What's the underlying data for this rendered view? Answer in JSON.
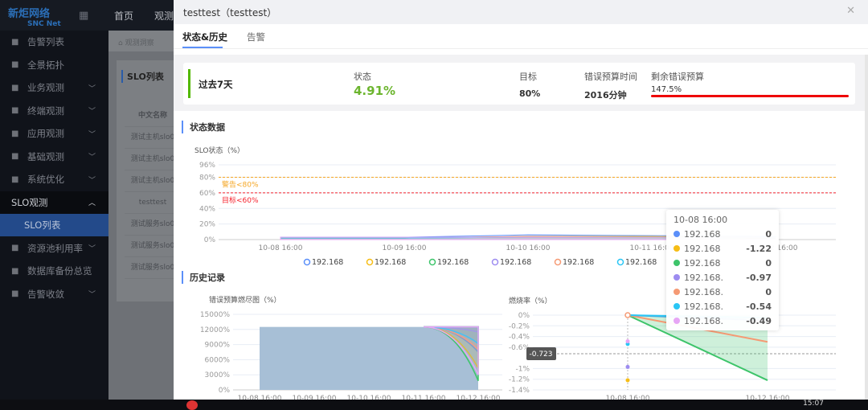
{
  "app": {
    "logo_cn": "新炬网络",
    "logo_en": "SNC Net",
    "nav": [
      "首页",
      "观测"
    ]
  },
  "sidebar": {
    "items": [
      {
        "label": "告警列表",
        "icon": "alert-list-icon",
        "chev": false
      },
      {
        "label": "全景拓扑",
        "icon": "topology-icon",
        "chev": false
      },
      {
        "label": "业务观测",
        "icon": "business-chart-icon",
        "chev": true
      },
      {
        "label": "终端观测",
        "icon": "globe-icon",
        "chev": true
      },
      {
        "label": "应用观测",
        "icon": "app-cluster-icon",
        "chev": true
      },
      {
        "label": "基础观测",
        "icon": "grid-icon",
        "chev": true
      },
      {
        "label": "系统优化",
        "icon": "system-icon",
        "chev": true
      },
      {
        "label": "SLO观测",
        "icon": "",
        "chev": true,
        "expanded": true
      },
      {
        "label": "SLO列表",
        "icon": "",
        "active": true
      },
      {
        "label": "资源池利用率",
        "icon": "resource-icon",
        "chev": true
      },
      {
        "label": "数据库备份总览",
        "icon": "database-icon",
        "chev": false
      },
      {
        "label": "告警收敛",
        "icon": "alert-converge-icon",
        "chev": true
      }
    ]
  },
  "background": {
    "breadcrumb": "观测洞察",
    "list_title": "SLO列表",
    "column": "中文名称",
    "rows": [
      "测试主机slo0",
      "测试主机slo0",
      "测试主机slo0",
      "testtest",
      "测试服务slo0",
      "测试服务slo0",
      "测试服务slo0"
    ]
  },
  "drawer": {
    "title": "testtest（testtest）",
    "tabs": [
      "状态&历史",
      "告警"
    ],
    "summary": {
      "period": "过去7天",
      "status_label": "状态",
      "status_value": "4.91%",
      "target_label": "目标",
      "target_value": "80%",
      "budget_time_label": "错误预算时间",
      "budget_time_value": "2016分钟",
      "remaining_label": "剩余错误预算",
      "remaining_value": "147.5%"
    },
    "sections": {
      "status": "状态数据",
      "history": "历史记录"
    }
  },
  "colors": {
    "series": [
      "#5b8ff9",
      "#f6bd16",
      "#3dc46a",
      "#9d8cf0",
      "#f59a74",
      "#2ac6f5",
      "#e6a6f5"
    ],
    "warn": "#f5a623",
    "target": "#f5222d",
    "accent": "#5b8ff9",
    "good": "#52b800"
  },
  "chart_data": [
    {
      "type": "area",
      "ylabel": "SLO状态（%）",
      "yticks": [
        "0%",
        "20%",
        "40%",
        "60%",
        "80%",
        "96%"
      ],
      "ylim": [
        0,
        96
      ],
      "xticks": [
        "10-08 16:00",
        "10-09 16:00",
        "10-10 16:00",
        "10-11 16:00",
        "10-12 16:00"
      ],
      "thresholds": [
        {
          "label": "警告<80%",
          "value": 80
        },
        {
          "label": "目标<60%",
          "value": 60
        }
      ],
      "legend": [
        "192.168",
        "192.168",
        "192.168",
        "192.168",
        "192.168",
        "192.168",
        "192.168"
      ],
      "series": [
        {
          "values": [
            3,
            3,
            6,
            5,
            4
          ]
        },
        {
          "values": [
            2,
            2,
            4,
            4,
            3
          ]
        },
        {
          "values": [
            2,
            2,
            3,
            3,
            2
          ]
        },
        {
          "values": [
            3,
            3,
            3,
            3,
            3
          ]
        },
        {
          "values": [
            2,
            2,
            4,
            3,
            3
          ]
        },
        {
          "values": [
            2,
            2,
            3,
            3,
            3
          ]
        },
        {
          "values": [
            3,
            3,
            3,
            3,
            3
          ]
        }
      ]
    },
    {
      "type": "area",
      "ylabel": "错误预算燃尽图（%）",
      "yticks": [
        "0%",
        "3000%",
        "6000%",
        "9000%",
        "12000%",
        "15000%"
      ],
      "ylim": [
        0,
        15000
      ],
      "xticks": [
        "10-08 16:00",
        "10-09 16:00",
        "10-10 16:00",
        "10-11 16:00",
        "10-12 16:00"
      ],
      "series": [
        {
          "values": [
            12500,
            12500,
            12500,
            12500,
            7500
          ]
        },
        {
          "values": [
            12500,
            12500,
            12500,
            12500,
            4300
          ]
        },
        {
          "values": [
            12500,
            12500,
            12500,
            12500,
            1800
          ]
        },
        {
          "values": [
            12500,
            12500,
            12500,
            12500,
            11500
          ]
        },
        {
          "values": [
            12500,
            12500,
            12500,
            12500,
            8000
          ]
        },
        {
          "values": [
            12500,
            12500,
            12500,
            12500,
            9200
          ]
        },
        {
          "values": [
            12500,
            12500,
            12500,
            12500,
            3000
          ]
        }
      ]
    },
    {
      "type": "line",
      "ylabel": "燃烧率（%）",
      "yticks": [
        "0%",
        "-0.2%",
        "-0.4%",
        "-0.6%",
        "-1%",
        "-1.2%",
        "-1.4%"
      ],
      "ylim": [
        -1.4,
        0
      ],
      "xticks": [
        "10-08 16:00",
        "10-12 16:00"
      ],
      "crosshair": "-0.723",
      "points_at_start": [
        0,
        -1.22,
        0,
        -0.97,
        0,
        -0.54,
        -0.49
      ],
      "series_end": [
        -0.1,
        null,
        -1.22,
        null,
        -0.5,
        -0.05,
        null
      ],
      "tooltip": {
        "title": "10-08 16:00",
        "rows": [
          {
            "name": "192.168",
            "value": "0"
          },
          {
            "name": "192.168",
            "value": "-1.22"
          },
          {
            "name": "192.168",
            "value": "0"
          },
          {
            "name": "192.168.",
            "value": "-0.97"
          },
          {
            "name": "192.168.",
            "value": "0"
          },
          {
            "name": "192.168.",
            "value": "-0.54"
          },
          {
            "name": "192.168.",
            "value": "-0.49"
          }
        ]
      }
    }
  ],
  "taskbar": {
    "clock": "15:07"
  }
}
